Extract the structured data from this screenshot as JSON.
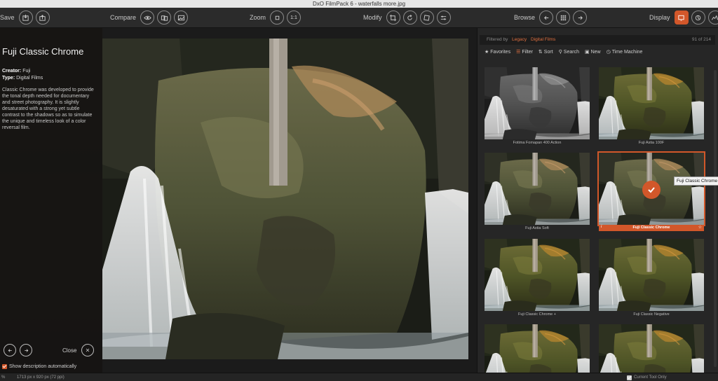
{
  "window": {
    "title": "DxO FilmPack 6 - waterfalls more.jpg"
  },
  "toolbar": {
    "save_label": "Save",
    "compare_label": "Compare",
    "zoom_label": "Zoom",
    "zoom_fit_label": "1:1",
    "modify_label": "Modify",
    "browse_label": "Browse",
    "display_label": "Display"
  },
  "description_panel": {
    "title": "Fuji Classic Chrome",
    "creator_label": "Creator:",
    "creator_value": "Fuji",
    "type_label": "Type:",
    "type_value": "Digital Films",
    "description": "Classic Chrome was developed to provide the tonal depth needed for documentary and street photography. It is slightly desaturated with a strong yet subtle contrast to the shadows so as to simulate the unique and timeless look of a color reversal film.",
    "close_label": "Close",
    "show_auto_label": "Show description automatically"
  },
  "browser": {
    "filtered_by_label": "Filtered by",
    "filter_legacy": "Legacy",
    "filter_digital": "Digital Films",
    "count": "91 of 214",
    "tools": {
      "favorites": "Favorites",
      "filter": "Filter",
      "sort": "Sort",
      "search": "Search",
      "new": "New",
      "time_machine": "Time Machine"
    },
    "thumbnails": [
      {
        "name": "Fotima Fomapan 400 Action",
        "style": "bw"
      },
      {
        "name": "Fuji Astia 100F",
        "style": "warm"
      },
      {
        "name": "Fuji Astia Soft",
        "style": "soft"
      },
      {
        "name": "Fuji Classic Chrome",
        "style": "chrome",
        "selected": true
      },
      {
        "name": "Fuji Classic Chrome +",
        "style": "chrome"
      },
      {
        "name": "Fuji Classic Negative",
        "style": "neg"
      },
      {
        "name": "",
        "style": "chrome"
      },
      {
        "name": "",
        "style": "warm"
      }
    ],
    "tooltip": "Fuji Classic Chrome"
  },
  "statusbar": {
    "zoom": "%",
    "dimensions": "1713 px x 920 px (72 ppi)",
    "current_tool_only": "Current Tool Only"
  },
  "colors": {
    "accent": "#d2572a",
    "bg": "#1b1b1b",
    "panel": "#262626"
  }
}
